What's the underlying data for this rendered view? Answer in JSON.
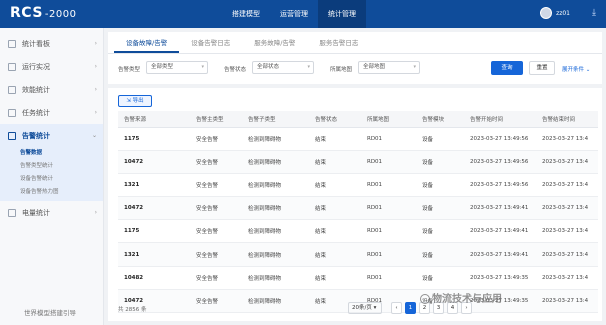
{
  "app": {
    "logo": "RCS",
    "logo_suffix": "-2000"
  },
  "topnav": [
    "搭建模型",
    "运营管理",
    "统计管理"
  ],
  "user": {
    "name": "zz01"
  },
  "sidebar": {
    "items": [
      "统计看板",
      "运行实况",
      "效能统计",
      "任务统计"
    ],
    "active_group": "告警统计",
    "sub_items": [
      "告警数据",
      "告警类型统计",
      "设备告警统计",
      "设备告警热力图"
    ],
    "after": [
      "电量统计"
    ],
    "guide": "世界模型搭建引导"
  },
  "tabs": [
    "设备故障/告警",
    "设备告警日志",
    "服务故障/告警",
    "服务告警日志"
  ],
  "filters": {
    "alarm_type_label": "告警类型",
    "alarm_type_value": "全部类型",
    "alarm_status_label": "告警状态",
    "alarm_status_value": "全部状态",
    "map_label": "所属地图",
    "map_value": "全部地图",
    "query": "查询",
    "reset": "重置",
    "expand": "展开条件"
  },
  "export": "导出",
  "table": {
    "headers": [
      "告警来源",
      "告警主类型",
      "告警子类型",
      "告警状态",
      "所属地图",
      "告警模块",
      "告警开始时间",
      "告警结束时间"
    ],
    "rows": [
      [
        "1175",
        "安全告警",
        "检测到障碍物",
        "结束",
        "RD01",
        "设备",
        "2023-03-27 13:49:56",
        "2023-03-27 13:4"
      ],
      [
        "10472",
        "安全告警",
        "检测到障碍物",
        "结束",
        "RD01",
        "设备",
        "2023-03-27 13:49:56",
        "2023-03-27 13:4"
      ],
      [
        "1321",
        "安全告警",
        "检测到障碍物",
        "结束",
        "RD01",
        "设备",
        "2023-03-27 13:49:56",
        "2023-03-27 13:4"
      ],
      [
        "10472",
        "安全告警",
        "检测到障碍物",
        "结束",
        "RD01",
        "设备",
        "2023-03-27 13:49:41",
        "2023-03-27 13:4"
      ],
      [
        "1175",
        "安全告警",
        "检测到障碍物",
        "结束",
        "RD01",
        "设备",
        "2023-03-27 13:49:41",
        "2023-03-27 13:4"
      ],
      [
        "1321",
        "安全告警",
        "检测到障碍物",
        "结束",
        "RD01",
        "设备",
        "2023-03-27 13:49:41",
        "2023-03-27 13:4"
      ],
      [
        "10482",
        "安全告警",
        "检测到障碍物",
        "结束",
        "RD01",
        "设备",
        "2023-03-27 13:49:35",
        "2023-03-27 13:4"
      ],
      [
        "10472",
        "安全告警",
        "检测到障碍物",
        "结束",
        "RD01",
        "设备",
        "2023-03-27 13:49:35",
        "2023-03-27 13:4"
      ]
    ]
  },
  "footer": {
    "total": "共 2856 条",
    "page_size": "20条/页",
    "pages": [
      "‹",
      "1",
      "2",
      "3",
      "4",
      "›"
    ]
  },
  "watermark": "物流技术与应用"
}
